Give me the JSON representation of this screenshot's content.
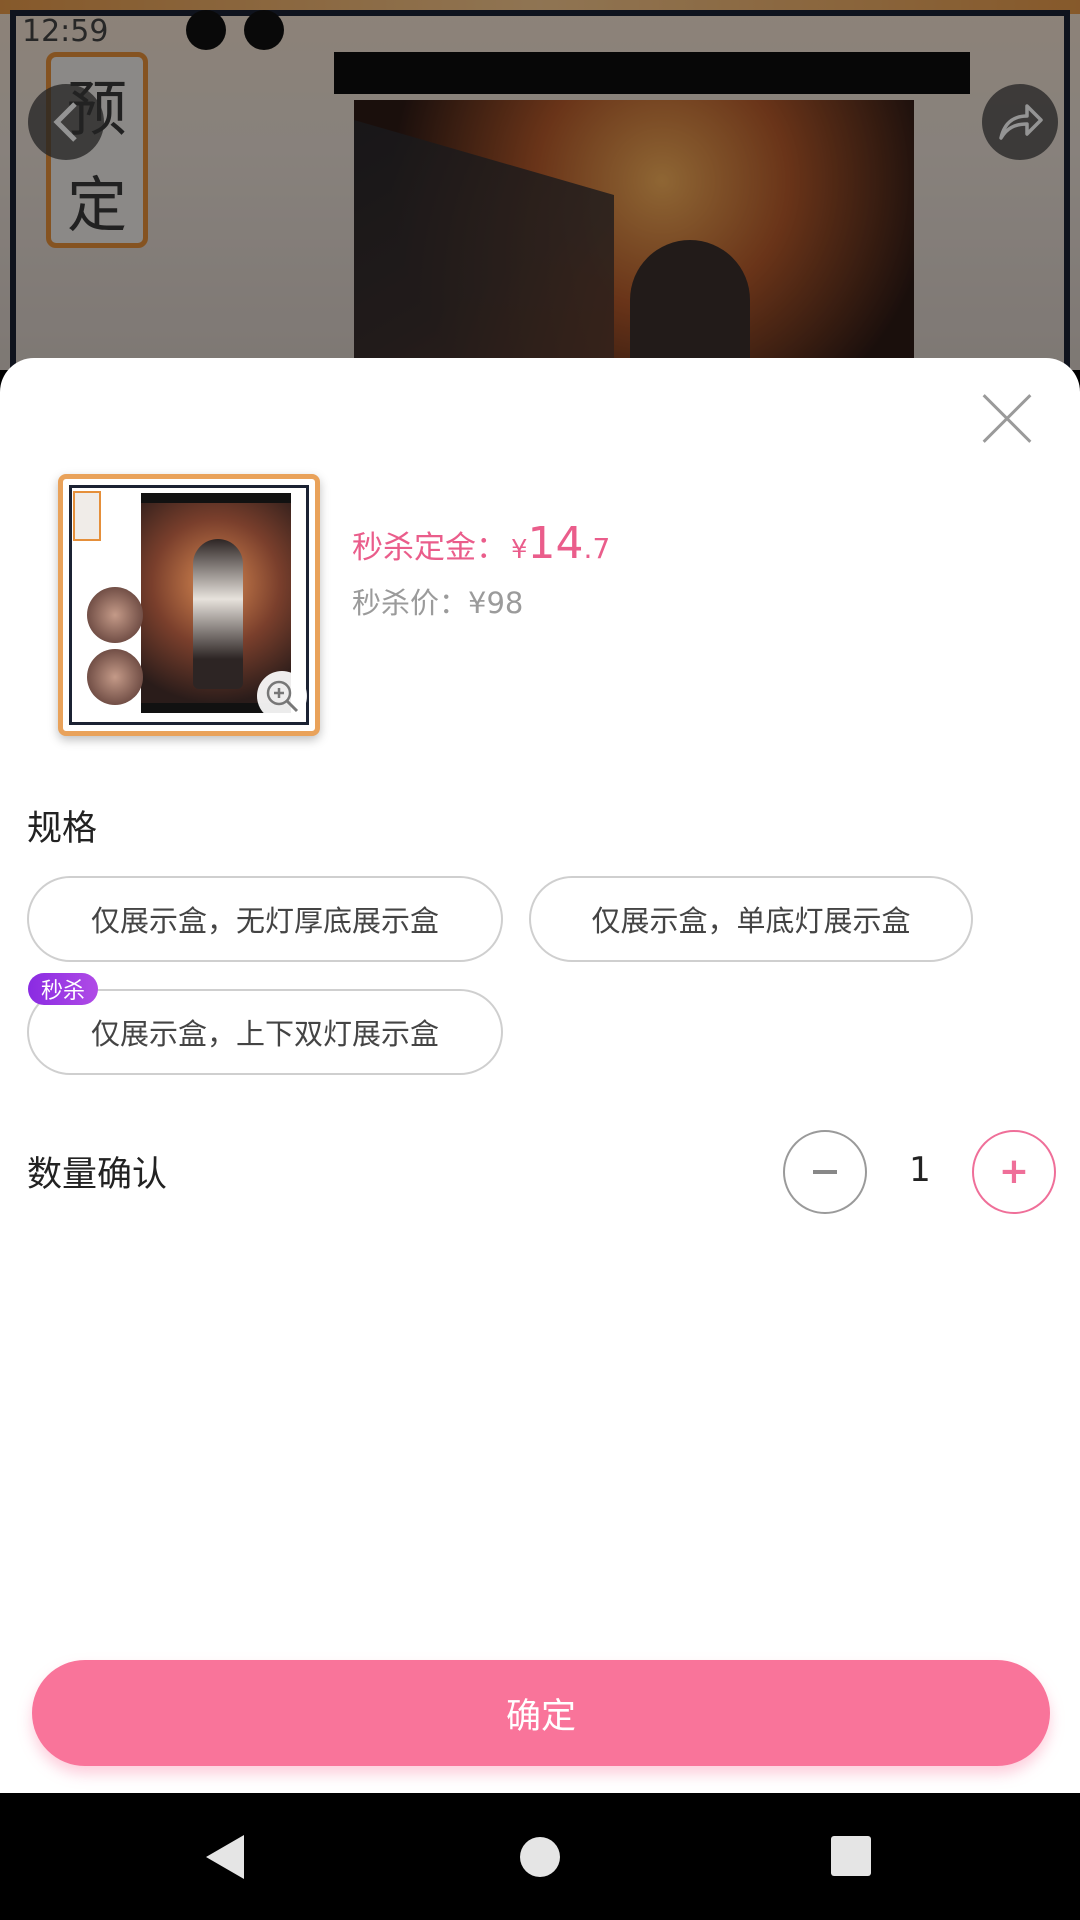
{
  "status_bar": {
    "time": "12:59"
  },
  "background": {
    "badge_chars": [
      "预",
      "定"
    ]
  },
  "sheet": {
    "price": {
      "label": "秒杀定金：",
      "currency": "¥",
      "integer": "14",
      "decimal": ".7",
      "sub_label": "秒杀价：¥98"
    },
    "spec_title": "规格",
    "options": [
      {
        "label": "仅展示盒，无灯厚底展示盒"
      },
      {
        "label": "仅展示盒，单底灯展示盒"
      },
      {
        "label": "仅展示盒，上下双灯展示盒",
        "tag": "秒杀"
      }
    ],
    "quantity": {
      "label": "数量确认",
      "value": "1",
      "minus": "−",
      "plus": "+"
    },
    "confirm_label": "确定"
  },
  "colors": {
    "accent_pink": "#f9749a",
    "price_pink": "#ea5d8b",
    "tag_purple": "#8a2be2"
  }
}
